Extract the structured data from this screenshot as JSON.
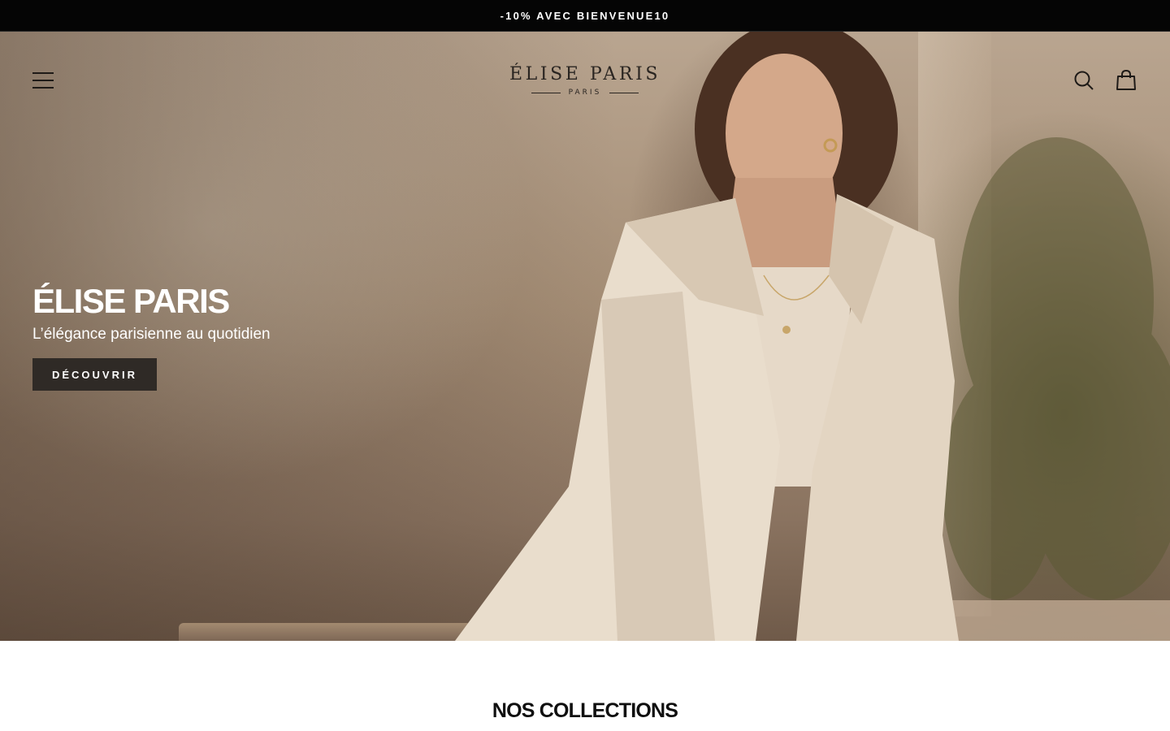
{
  "announcement": {
    "text": "-10% AVEC BIENVENUE10"
  },
  "header": {
    "logo_name": "ÉLISE PARIS",
    "logo_sub": "PARIS",
    "menu_icon": "menu-icon",
    "search_icon": "search-icon",
    "cart_icon": "cart-icon"
  },
  "hero": {
    "title": "ÉLISE PARIS",
    "subtitle": "L’élégance parisienne au quotidien",
    "cta_label": "DÉCOUVRIR"
  },
  "collections": {
    "title": "NOS COLLECTIONS"
  },
  "colors": {
    "announcement_bg": "#050505",
    "cta_bg": "#2f2a26",
    "hero_tone": "#a48d75",
    "text_light": "#ffffff"
  }
}
